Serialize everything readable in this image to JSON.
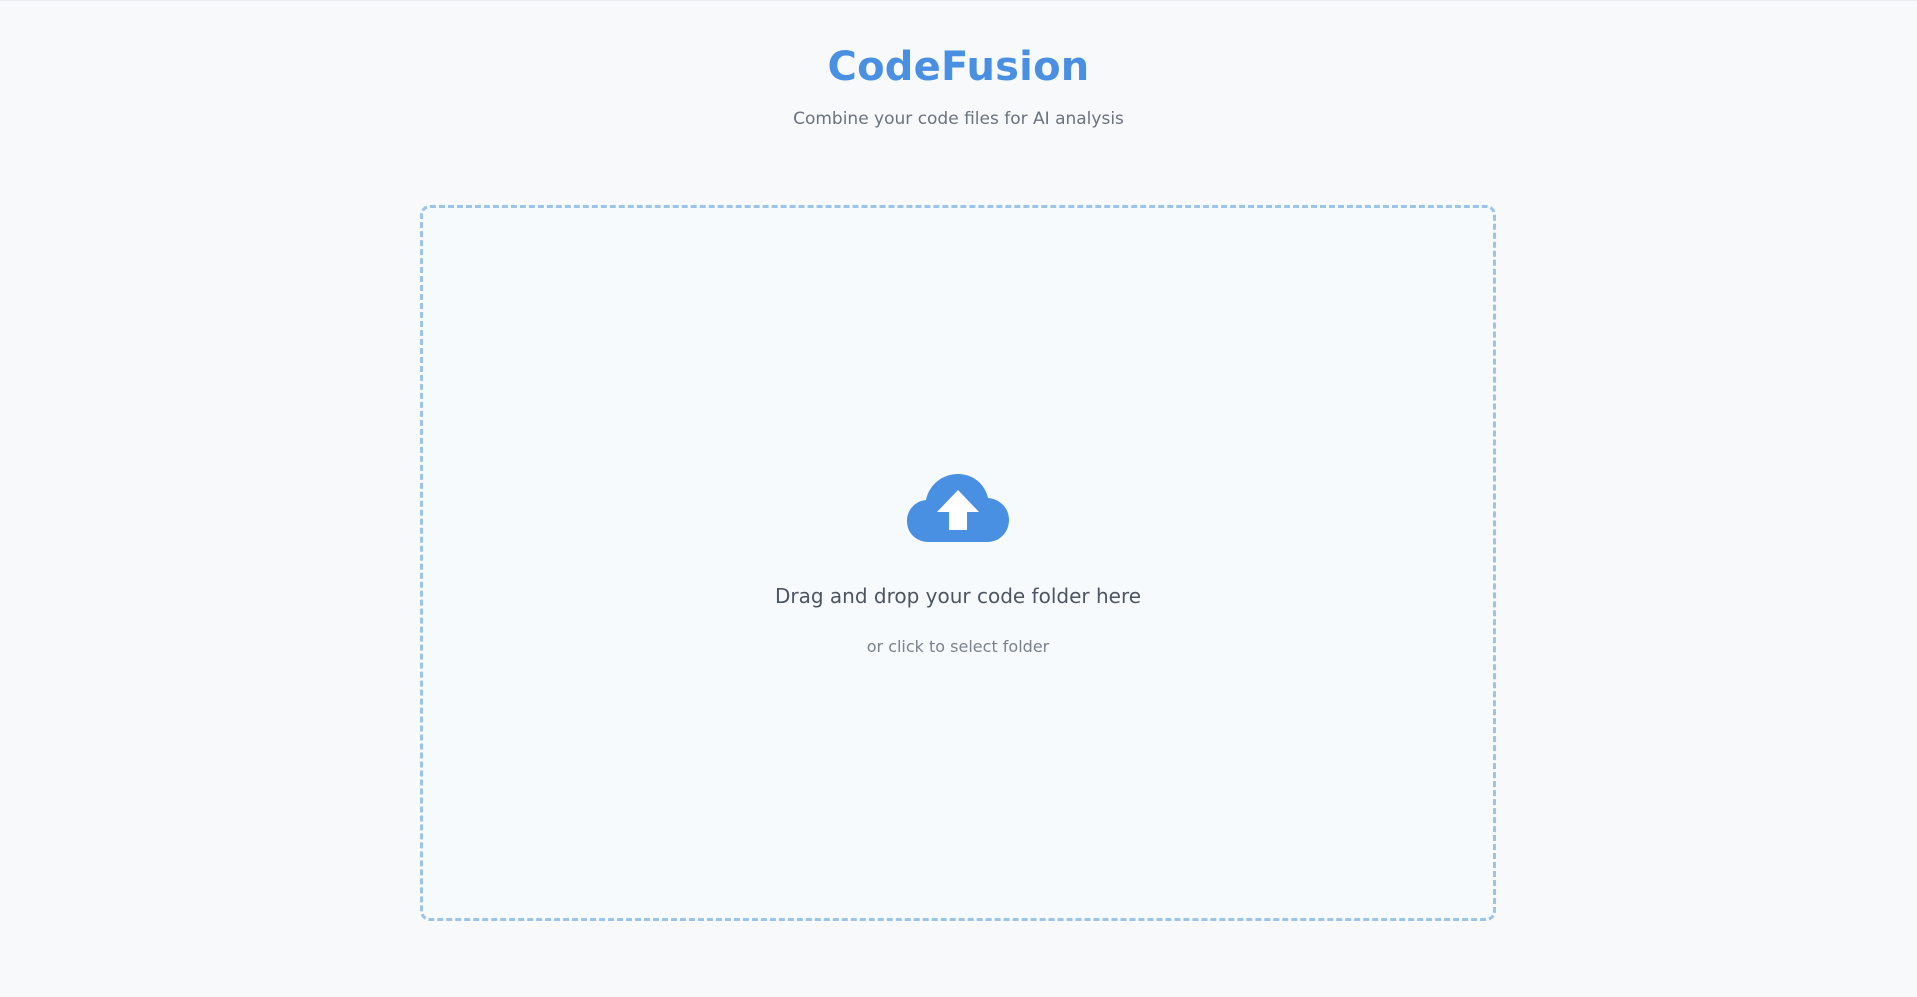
{
  "app": {
    "title": "CodeFusion",
    "subtitle": "Combine your code files for AI analysis"
  },
  "dropzone": {
    "icon": "cloud-upload-icon",
    "main_text": "Drag and drop your code folder here",
    "hint_text": "or click to select folder"
  },
  "colors": {
    "accent": "#4a90e2",
    "border": "#9cc3e8",
    "background": "#f7f9fb"
  }
}
